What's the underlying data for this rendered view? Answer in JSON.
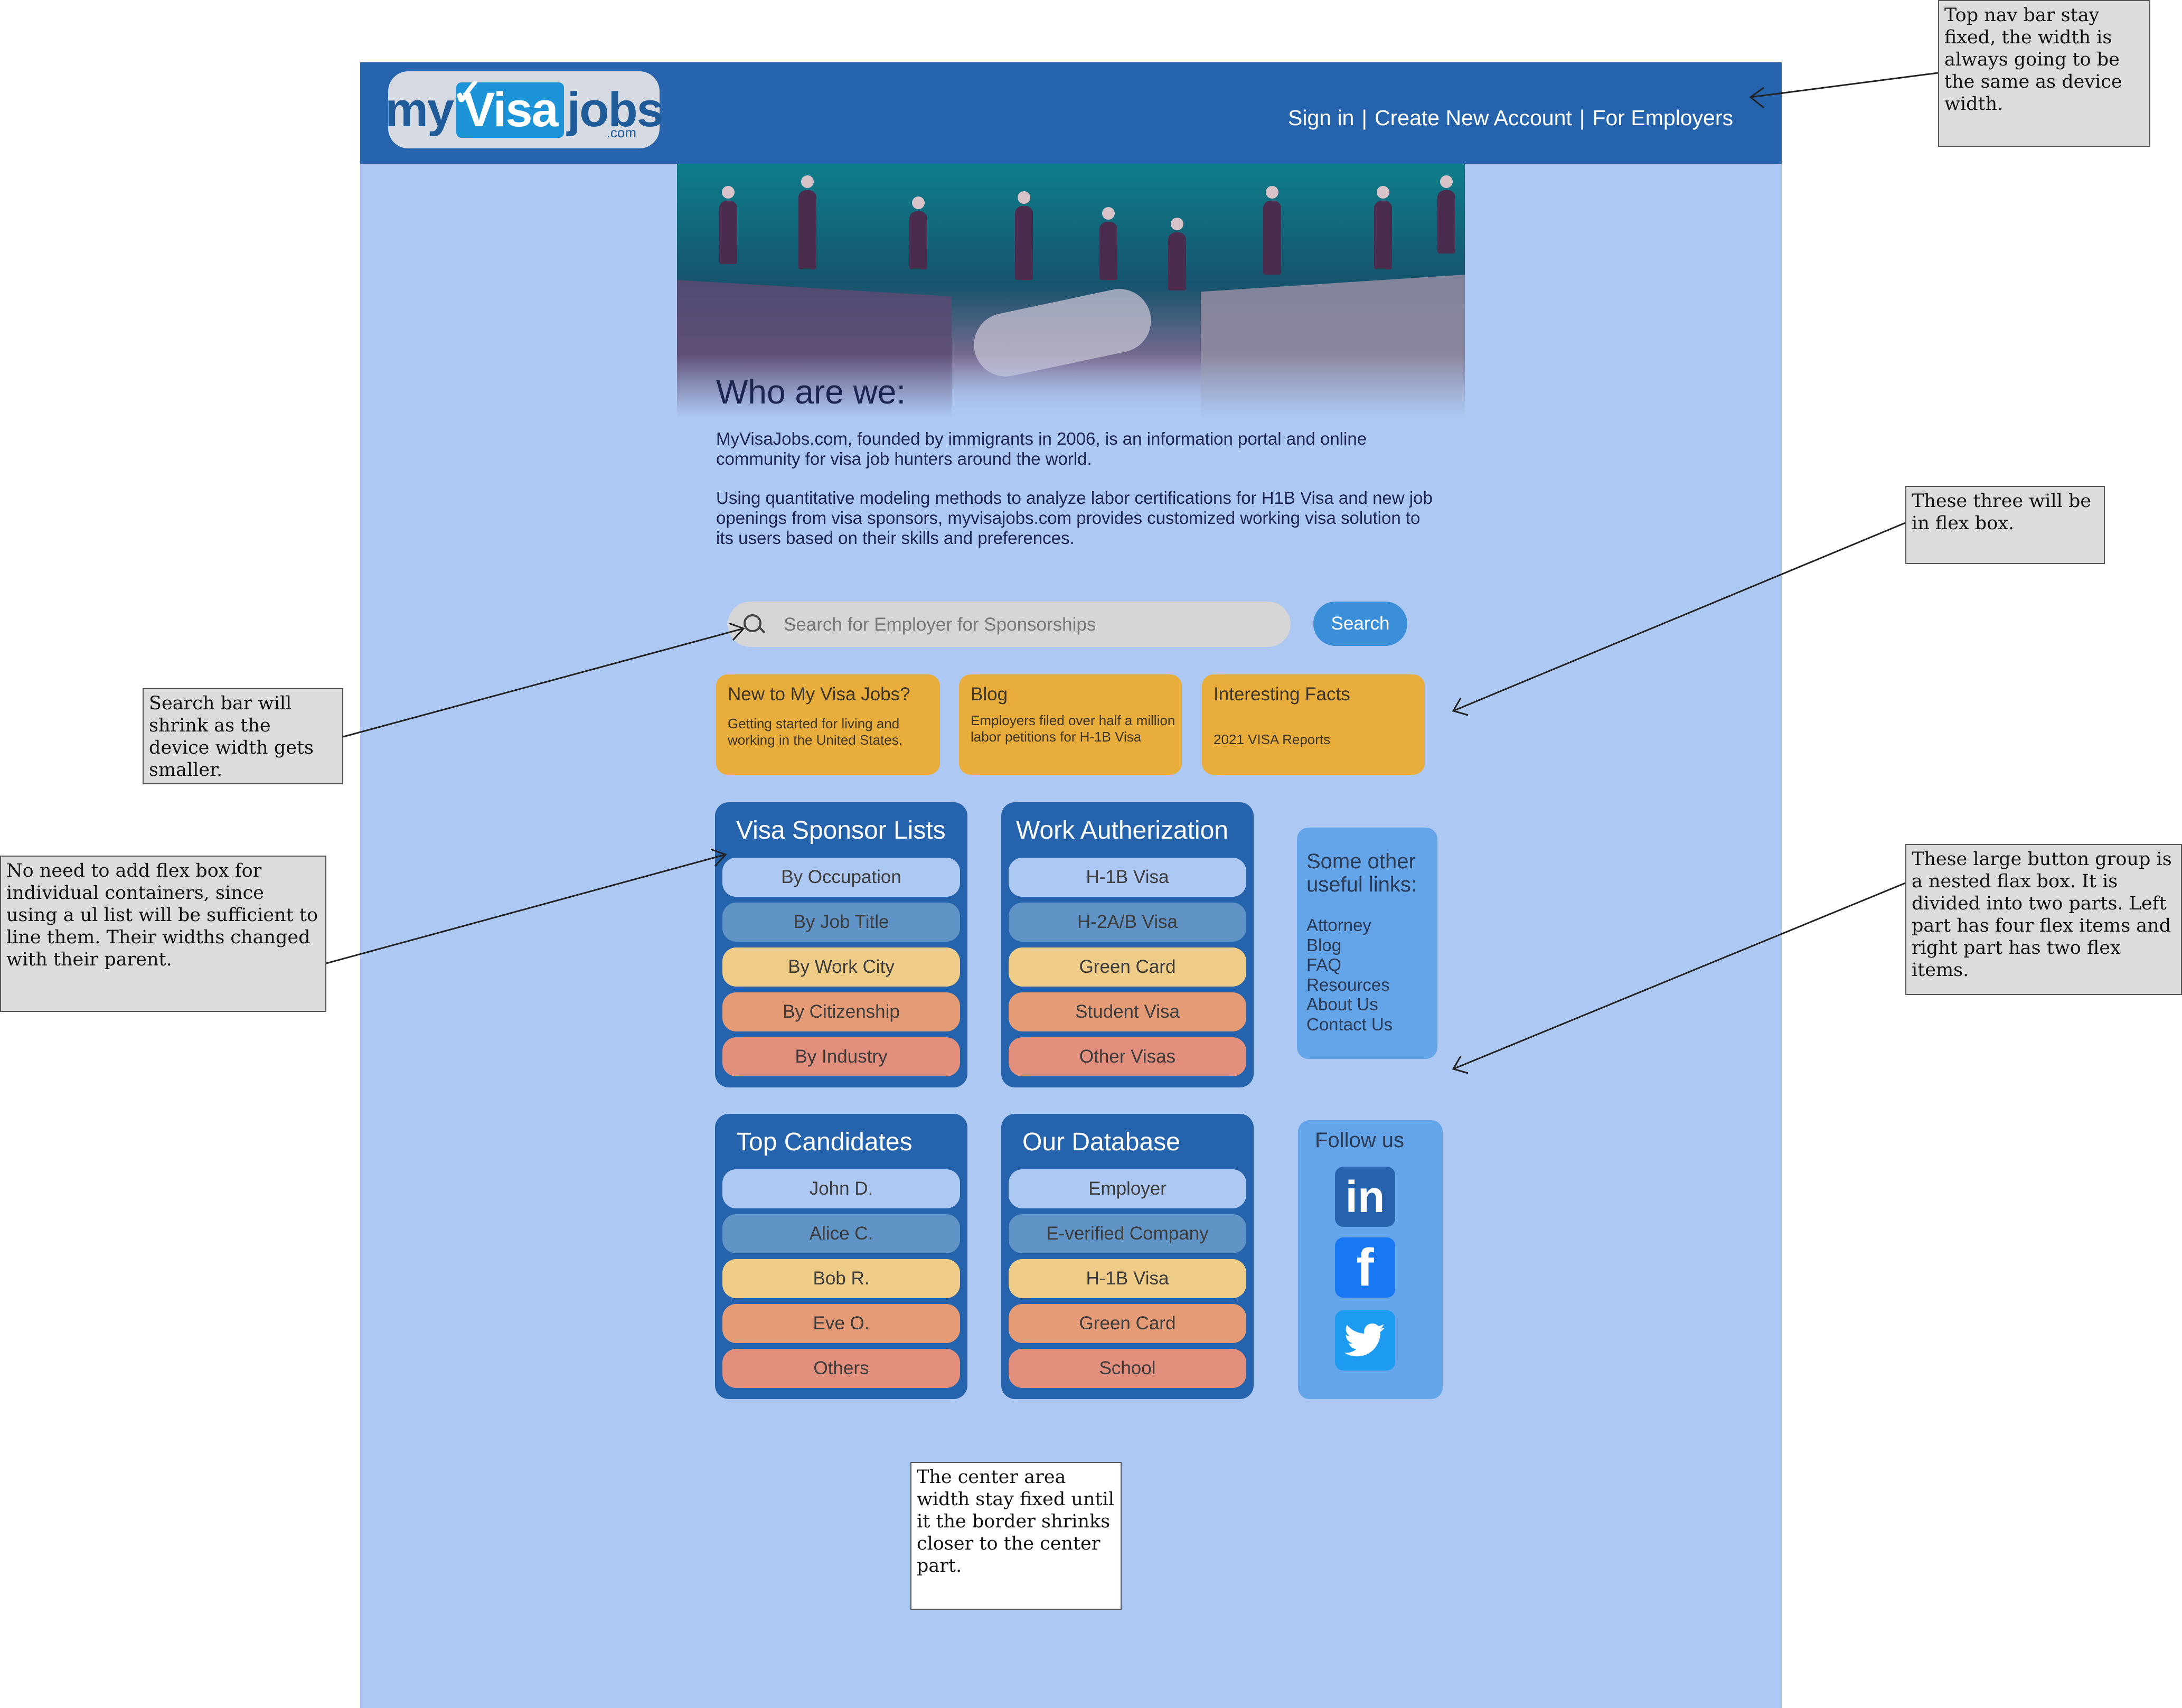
{
  "nav": {
    "logo": {
      "my": "my",
      "visa": "Visa",
      "jobs": "jobs",
      "com": ".com"
    },
    "links": [
      "Sign in",
      "Create New Account",
      "For Employers"
    ],
    "separator": "|",
    "color": "#2564ad"
  },
  "hero": {
    "title": "Who are we:",
    "p1": "MyVisaJobs.com, founded by immigrants in 2006, is an information portal and online community for visa job hunters around the world.",
    "p2": "Using quantitative modeling methods to analyze labor certifications for H1B Visa and new job openings from visa sponsors, myvisajobs.com provides customized working visa solution to its users based on their skills and preferences."
  },
  "search": {
    "placeholder": "Search for Employer for Sponsorships",
    "button": "Search"
  },
  "cards": [
    {
      "title": "New to My Visa Jobs?",
      "body": "Getting started for living and working in the United States."
    },
    {
      "title": "Blog",
      "body": "Employers filed over half a million labor petitions for H-1B Visa"
    },
    {
      "title": "Interesting Facts",
      "body": "2021 VISA Reports"
    }
  ],
  "groups": {
    "sponsor": {
      "title": "Visa Sponsor Lists",
      "items": [
        "By Occupation",
        "By Job Title",
        "By Work City",
        "By Citizenship",
        "By Industry"
      ]
    },
    "work": {
      "title": "Work Autherization",
      "items": [
        "H-1B Visa",
        "H-2A/B Visa",
        "Green Card",
        "Student Visa",
        "Other Visas"
      ]
    },
    "candidates": {
      "title": "Top Candidates",
      "items": [
        "John D.",
        "Alice C.",
        "Bob R.",
        "Eve O.",
        "Others"
      ]
    },
    "database": {
      "title": "Our Database",
      "items": [
        "Employer",
        "E-verified Company",
        "H-1B Visa",
        "Green Card",
        "School"
      ]
    }
  },
  "useful": {
    "title": "Some other useful links:",
    "links": [
      "Attorney",
      "Blog",
      "FAQ",
      "Resources",
      "About Us",
      "Contact Us"
    ]
  },
  "follow": {
    "title": "Follow us",
    "icons": [
      "linkedin-icon",
      "facebook-icon",
      "twitter-icon"
    ],
    "linkedin": "in",
    "facebook": "f"
  },
  "notes": {
    "nav": "Top nav bar stay fixed, the width is always going to be the same as device width.",
    "three": "These three will be in flex box.",
    "search": "Search bar will shrink as the device width gets smaller.",
    "ul": "No need to add flex box for individual containers, since using a ul list will be sufficient to line them. Their widths changed with their parent.",
    "nested": "These large button group is a nested flax box. It is divided into two parts. Left part has four flex items and right part has two flex items.",
    "center": "The center area width stay fixed until it the border shrinks closer to the center part."
  },
  "colors": {
    "page_bg": "#adc8f2",
    "card": "#e9ad3c",
    "group": "#2563ac",
    "side_box": "#64a5e9",
    "button_1": "#adc8f2",
    "button_2": "#6194c6",
    "button_3": "#efcc88",
    "button_4": "#e59c76",
    "button_5": "#e28f7e"
  }
}
